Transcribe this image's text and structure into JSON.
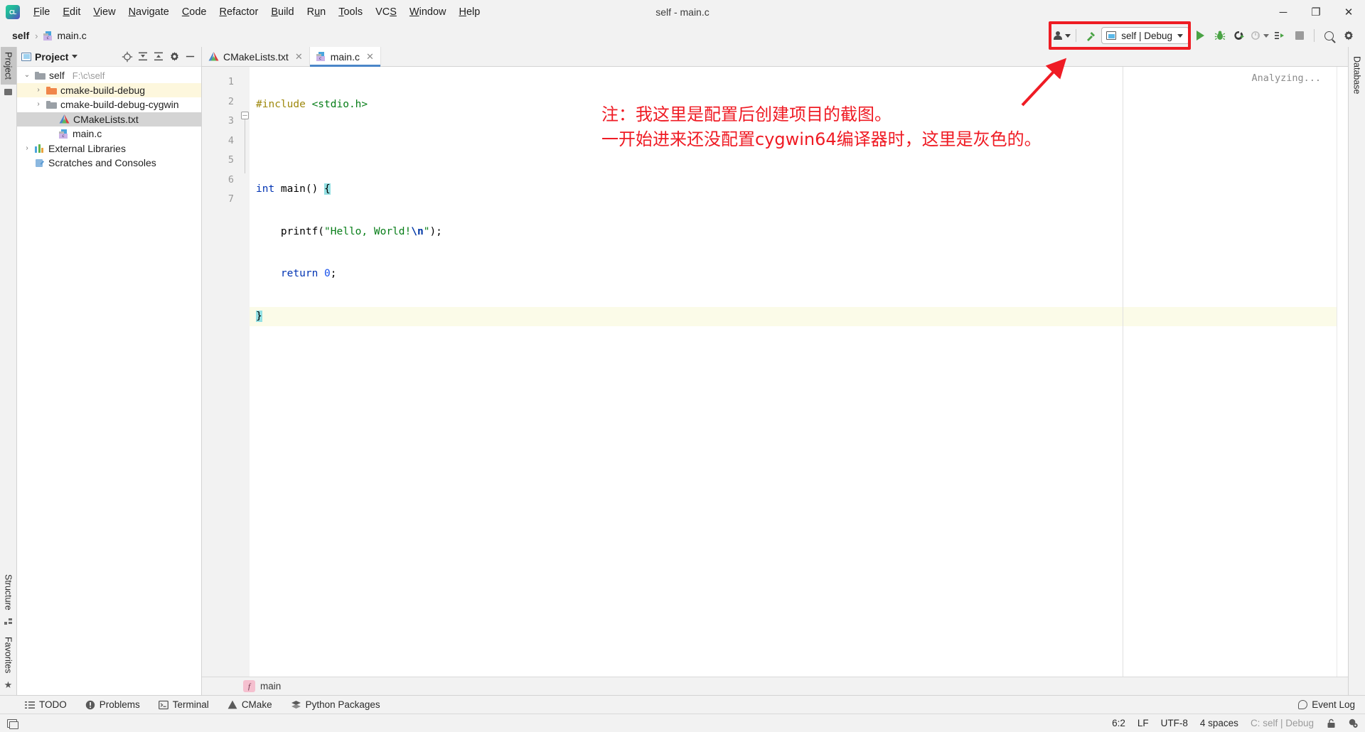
{
  "window": {
    "title": "self - main.c",
    "app_name": "CLion",
    "logo_text": "CL",
    "controls": {
      "minimize": "─",
      "maximize": "❐",
      "close": "✕"
    }
  },
  "menu": [
    {
      "label": "File"
    },
    {
      "label": "Edit"
    },
    {
      "label": "View"
    },
    {
      "label": "Navigate"
    },
    {
      "label": "Code"
    },
    {
      "label": "Refactor"
    },
    {
      "label": "Build"
    },
    {
      "label": "Run"
    },
    {
      "label": "Tools"
    },
    {
      "label": "VCS"
    },
    {
      "label": "Window"
    },
    {
      "label": "Help"
    }
  ],
  "navbar": {
    "breadcrumbs": [
      {
        "label": "self"
      },
      {
        "label": "main.c"
      }
    ],
    "separator": "›",
    "run_config": {
      "name": "self | Debug",
      "dropdown_icon": "chevron-down-icon"
    },
    "buttons": [
      {
        "name": "run-button",
        "label": "Run"
      },
      {
        "name": "debug-button",
        "label": "Debug"
      },
      {
        "name": "run-coverage-button",
        "label": "Run with Coverage"
      },
      {
        "name": "profile-button",
        "label": "Profile"
      },
      {
        "name": "attach-button",
        "label": "Attach to Process"
      },
      {
        "name": "stop-button",
        "label": "Stop"
      },
      {
        "name": "search-everywhere-button",
        "label": "Search Everywhere"
      },
      {
        "name": "settings-button",
        "label": "Settings"
      }
    ]
  },
  "left_stripe": {
    "top": [
      {
        "label": "Project",
        "active": true
      }
    ],
    "bottom": [
      {
        "label": "Structure",
        "active": false
      },
      {
        "label": "Favorites",
        "active": false
      }
    ]
  },
  "project_pane": {
    "title": "Project",
    "tree": [
      {
        "label": "self",
        "path": "F:\\c\\self",
        "indent": 0,
        "arrow": "⌄",
        "icon": "folder-icon",
        "state": "normal"
      },
      {
        "label": "cmake-build-debug",
        "path": "",
        "indent": 1,
        "arrow": "›",
        "icon": "folder-orange-icon",
        "state": "highlight"
      },
      {
        "label": "cmake-build-debug-cygwin",
        "path": "",
        "indent": 1,
        "arrow": "›",
        "icon": "folder-icon",
        "state": "normal"
      },
      {
        "label": "CMakeLists.txt",
        "path": "",
        "indent": 2,
        "arrow": "",
        "icon": "cmake-icon",
        "state": "selected"
      },
      {
        "label": "main.c",
        "path": "",
        "indent": 2,
        "arrow": "",
        "icon": "c-file-icon",
        "state": "normal"
      },
      {
        "label": "External Libraries",
        "path": "",
        "indent": 0,
        "arrow": "›",
        "icon": "library-icon",
        "state": "normal"
      },
      {
        "label": "Scratches and Consoles",
        "path": "",
        "indent": 0,
        "arrow": "",
        "icon": "scratches-icon",
        "state": "normal"
      }
    ]
  },
  "editor": {
    "tabs": [
      {
        "label": "CMakeLists.txt",
        "icon": "cmake-icon",
        "active": false,
        "close": "✕"
      },
      {
        "label": "main.c",
        "icon": "c-file-icon",
        "active": true,
        "close": "✕"
      }
    ],
    "line_numbers": [
      "1",
      "2",
      "3",
      "4",
      "5",
      "6",
      "7"
    ],
    "code_lines": [
      {
        "n": 1,
        "tokens": [
          {
            "t": "#include",
            "c": "macro"
          },
          {
            "t": " ",
            "c": ""
          },
          {
            "t": "<stdio.h>",
            "c": "inc-str"
          }
        ]
      },
      {
        "n": 2,
        "tokens": []
      },
      {
        "n": 3,
        "tokens": [
          {
            "t": "int",
            "c": "kw"
          },
          {
            "t": " ",
            "c": ""
          },
          {
            "t": "main",
            "c": ""
          },
          {
            "t": "() ",
            "c": ""
          },
          {
            "t": "{",
            "c": "brc-hl"
          }
        ]
      },
      {
        "n": 4,
        "tokens": [
          {
            "t": "    ",
            "c": ""
          },
          {
            "t": "printf",
            "c": ""
          },
          {
            "t": "(",
            "c": ""
          },
          {
            "t": "\"Hello, World!",
            "c": "str"
          },
          {
            "t": "\\n",
            "c": "esc"
          },
          {
            "t": "\"",
            "c": "str"
          },
          {
            "t": ");",
            "c": ""
          }
        ]
      },
      {
        "n": 5,
        "tokens": [
          {
            "t": "    ",
            "c": ""
          },
          {
            "t": "return",
            "c": "kw"
          },
          {
            "t": " ",
            "c": ""
          },
          {
            "t": "0",
            "c": "num"
          },
          {
            "t": ";",
            "c": ""
          }
        ]
      },
      {
        "n": 6,
        "tokens": [
          {
            "t": "}",
            "c": "brc-hl"
          }
        ],
        "current": true
      },
      {
        "n": 7,
        "tokens": []
      }
    ],
    "status_hint": "Analyzing...",
    "breadcrumb": {
      "badge": "f",
      "label": "main"
    }
  },
  "annotation": {
    "line1": "注：我这里是配置后创建项目的截图。",
    "line2": "一开始进来还没配置cygwin64编译器时，这里是灰色的。",
    "color": "#ef1b24"
  },
  "right_stripe": {
    "items": [
      {
        "label": "Database"
      }
    ]
  },
  "bottom_bar": {
    "items": [
      {
        "label": "TODO",
        "icon": "todo-icon"
      },
      {
        "label": "Problems",
        "icon": "problems-icon"
      },
      {
        "label": "Terminal",
        "icon": "terminal-icon"
      },
      {
        "label": "CMake",
        "icon": "cmake-icon"
      },
      {
        "label": "Python Packages",
        "icon": "packages-icon"
      }
    ],
    "event_log": "Event Log"
  },
  "status_bar": {
    "caret": "6:2",
    "line_sep": "LF",
    "encoding": "UTF-8",
    "indent": "4 spaces",
    "toolchain": "C: self | Debug",
    "lock_icon": "lock-icon",
    "inspection_icon": "inspection-icon"
  },
  "colors": {
    "accent_blue": "#4a86c8",
    "annotation_red": "#ef1b24",
    "run_green": "#4aa345",
    "keyword_blue": "#0033b3",
    "string_green": "#067d17",
    "macro_yellow": "#9e880d",
    "brace_highlight": "#93e0e3",
    "current_line": "#fbfbe8",
    "selection_gray": "#d4d4d4",
    "panel_bg": "#f2f2f2"
  }
}
